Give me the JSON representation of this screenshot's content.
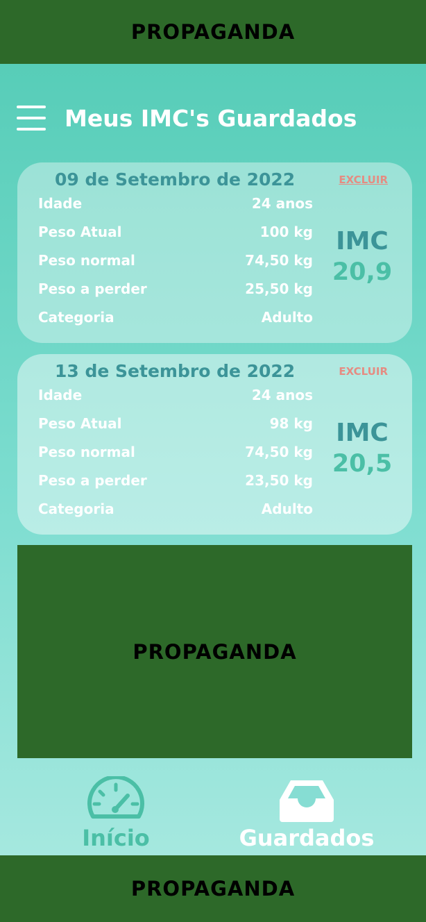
{
  "ads": {
    "top": "PROPAGANDA",
    "middle": "PROPAGANDA",
    "bottom": "PROPAGANDA"
  },
  "header": {
    "title": "Meus IMC's Guardados"
  },
  "records": [
    {
      "date": "09 de Setembro de 2022",
      "delete_label": "EXCLUIR",
      "rows": [
        {
          "label": "Idade",
          "value": "24 anos"
        },
        {
          "label": "Peso Atual",
          "value": "100 kg"
        },
        {
          "label": "Peso normal",
          "value": "74,50 kg"
        },
        {
          "label": "Peso a perder",
          "value": "25,50 kg"
        },
        {
          "label": "Categoria",
          "value": "Adulto"
        }
      ],
      "imc_label": "IMC",
      "imc_value": "20,9"
    },
    {
      "date": "13 de Setembro de 2022",
      "delete_label": "EXCLUIR",
      "rows": [
        {
          "label": "Idade",
          "value": "24 anos"
        },
        {
          "label": "Peso Atual",
          "value": "98 kg"
        },
        {
          "label": "Peso normal",
          "value": "74,50 kg"
        },
        {
          "label": "Peso a perder",
          "value": "23,50 kg"
        },
        {
          "label": "Categoria",
          "value": "Adulto"
        }
      ],
      "imc_label": "IMC",
      "imc_value": "20,5"
    }
  ],
  "nav": {
    "home": {
      "label": "Início",
      "icon": "speedometer-icon"
    },
    "saved": {
      "label": "Guardados",
      "icon": "inbox-icon"
    }
  },
  "colors": {
    "ad_green": "#2d6929",
    "teal_dark": "#3c9498",
    "teal_accent": "#4bbfa6",
    "delete_red": "#e58c82"
  }
}
